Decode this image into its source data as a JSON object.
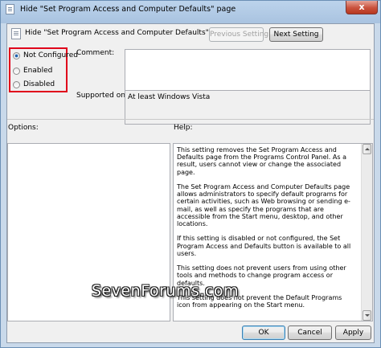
{
  "window": {
    "title": "Hide \"Set Program Access and Computer Defaults\" page",
    "close_glyph": "x"
  },
  "header": {
    "policy_name": "Hide \"Set Program Access and Computer Defaults\" page",
    "previous_label": "Previous Setting",
    "next_label": "Next Setting"
  },
  "state": {
    "options": [
      {
        "label": "Not Configured",
        "checked": true
      },
      {
        "label": "Enabled",
        "checked": false
      },
      {
        "label": "Disabled",
        "checked": false
      }
    ],
    "highlight_color": "#e0001b"
  },
  "fields": {
    "comment_label": "Comment:",
    "comment_value": "",
    "supported_label": "Supported on:",
    "supported_value": "At least Windows Vista"
  },
  "panels": {
    "options_label": "Options:",
    "help_label": "Help:",
    "help_paragraphs": [
      "This setting removes the Set Program Access and Defaults page from the Programs Control Panel.  As a result, users cannot view or change the associated page.",
      "The Set Program Access and Computer Defaults page allows administrators to specify default programs for certain activities, such as Web browsing or sending e-mail, as well as specify the programs that are accessible from the Start menu, desktop, and other locations.",
      "If this setting is disabled or not configured, the Set Program Access and Defaults button is available to all users.",
      "This setting does not prevent users from using other tools and methods to change program access or defaults.",
      "This setting does not prevent the Default Programs icon from appearing on the Start menu."
    ]
  },
  "footer": {
    "ok_label": "OK",
    "cancel_label": "Cancel",
    "apply_label": "Apply"
  },
  "watermark": "SevenForums.com",
  "icons": {
    "app": "policy-document-icon",
    "close": "close-icon",
    "scroll_up": "scroll-up-arrow-icon",
    "scroll_down": "scroll-down-arrow-icon"
  }
}
